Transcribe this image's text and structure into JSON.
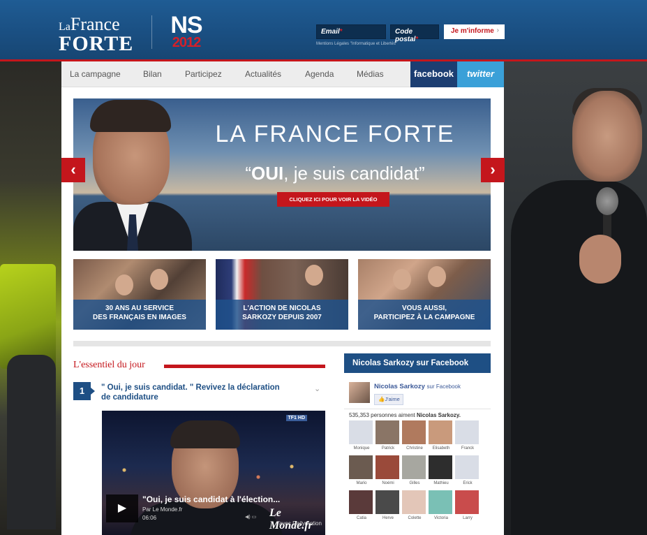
{
  "header": {
    "logo_la": "La",
    "logo_france": "France",
    "logo_forte": "FORTE",
    "ns_letters": "NS",
    "ns_year": "2012",
    "email_label": "Email",
    "postal_label": "Code postal",
    "required_mark": "*",
    "inform_button": "Je m'informe",
    "inform_arrow": "›",
    "mentions": "Mentions Légales \"Informatique et Libertés\""
  },
  "nav": {
    "items": [
      "La campagne",
      "Bilan",
      "Participez",
      "Actualités",
      "Agenda",
      "Médias"
    ],
    "facebook": "facebook",
    "twitter": "twitter"
  },
  "hero": {
    "title": "LA FRANCE FORTE",
    "quote_open": "“",
    "quote_bold": "OUI",
    "quote_rest": ", je suis candidat”",
    "cta": "CLIQUEZ ICI POUR VOIR LA VIDÉO",
    "prev_arrow": "‹",
    "next_arrow": "›"
  },
  "tiles": [
    {
      "line1": "30 ANS AU SERVICE",
      "line2": "DES FRANÇAIS EN IMAGES"
    },
    {
      "line1": "L'ACTION DE NICOLAS",
      "line2": "SARKOZY DEPUIS 2007"
    },
    {
      "line1": "VOUS AUSSI,",
      "line2": "PARTICIPEZ À LA CAMPAGNE"
    }
  ],
  "essentiel": {
    "title": "L'essentiel du jour",
    "number": "1",
    "headline": "\" Oui, je suis candidat. \" Revivez la déclaration de candidature",
    "chevron": "⌄"
  },
  "video": {
    "channel": "TF1 HD",
    "play": "▶",
    "title": "\"Oui, je suis candidat à l'élection...",
    "by": "Par Le Monde.fr",
    "duration": "06:06",
    "source_logo": "Le Monde.fr",
    "with": "avec Dailymotion",
    "controls": "◀) ▭"
  },
  "facebook": {
    "header": "Nicolas Sarkozy sur Facebook",
    "page_name": "Nicolas Sarkozy",
    "on_facebook": "sur Facebook",
    "like_button": "👍J'aime",
    "count_text": "535,353 personnes aiment",
    "count_name": "Nicolas Sarkozy.",
    "fans": [
      {
        "name": "Monique",
        "color": "#d9dde6"
      },
      {
        "name": "Patrick",
        "color": "#8a7566"
      },
      {
        "name": "Christine",
        "color": "#b07a5e"
      },
      {
        "name": "Elisabeth",
        "color": "#c99a7c"
      },
      {
        "name": "Franck",
        "color": "#d9dde6"
      },
      {
        "name": "Mario",
        "color": "#6b5b50"
      },
      {
        "name": "Noémi",
        "color": "#9a4a3a"
      },
      {
        "name": "Gilles",
        "color": "#a7a7a0"
      },
      {
        "name": "Mathieu",
        "color": "#2d2d2d"
      },
      {
        "name": "Erick",
        "color": "#d9dde6"
      },
      {
        "name": "Catia",
        "color": "#5a3a3a"
      },
      {
        "name": "Herve",
        "color": "#4a4a4a"
      },
      {
        "name": "Colette",
        "color": "#e3c6b8"
      },
      {
        "name": "Victoria",
        "color": "#7ac0b5"
      },
      {
        "name": "Larry",
        "color": "#c94c4c"
      }
    ]
  },
  "colors": {
    "brand_blue": "#1e4f84",
    "brand_red": "#c4161c",
    "facebook_blue": "#1c3e72",
    "twitter_blue": "#3aa0d8"
  }
}
